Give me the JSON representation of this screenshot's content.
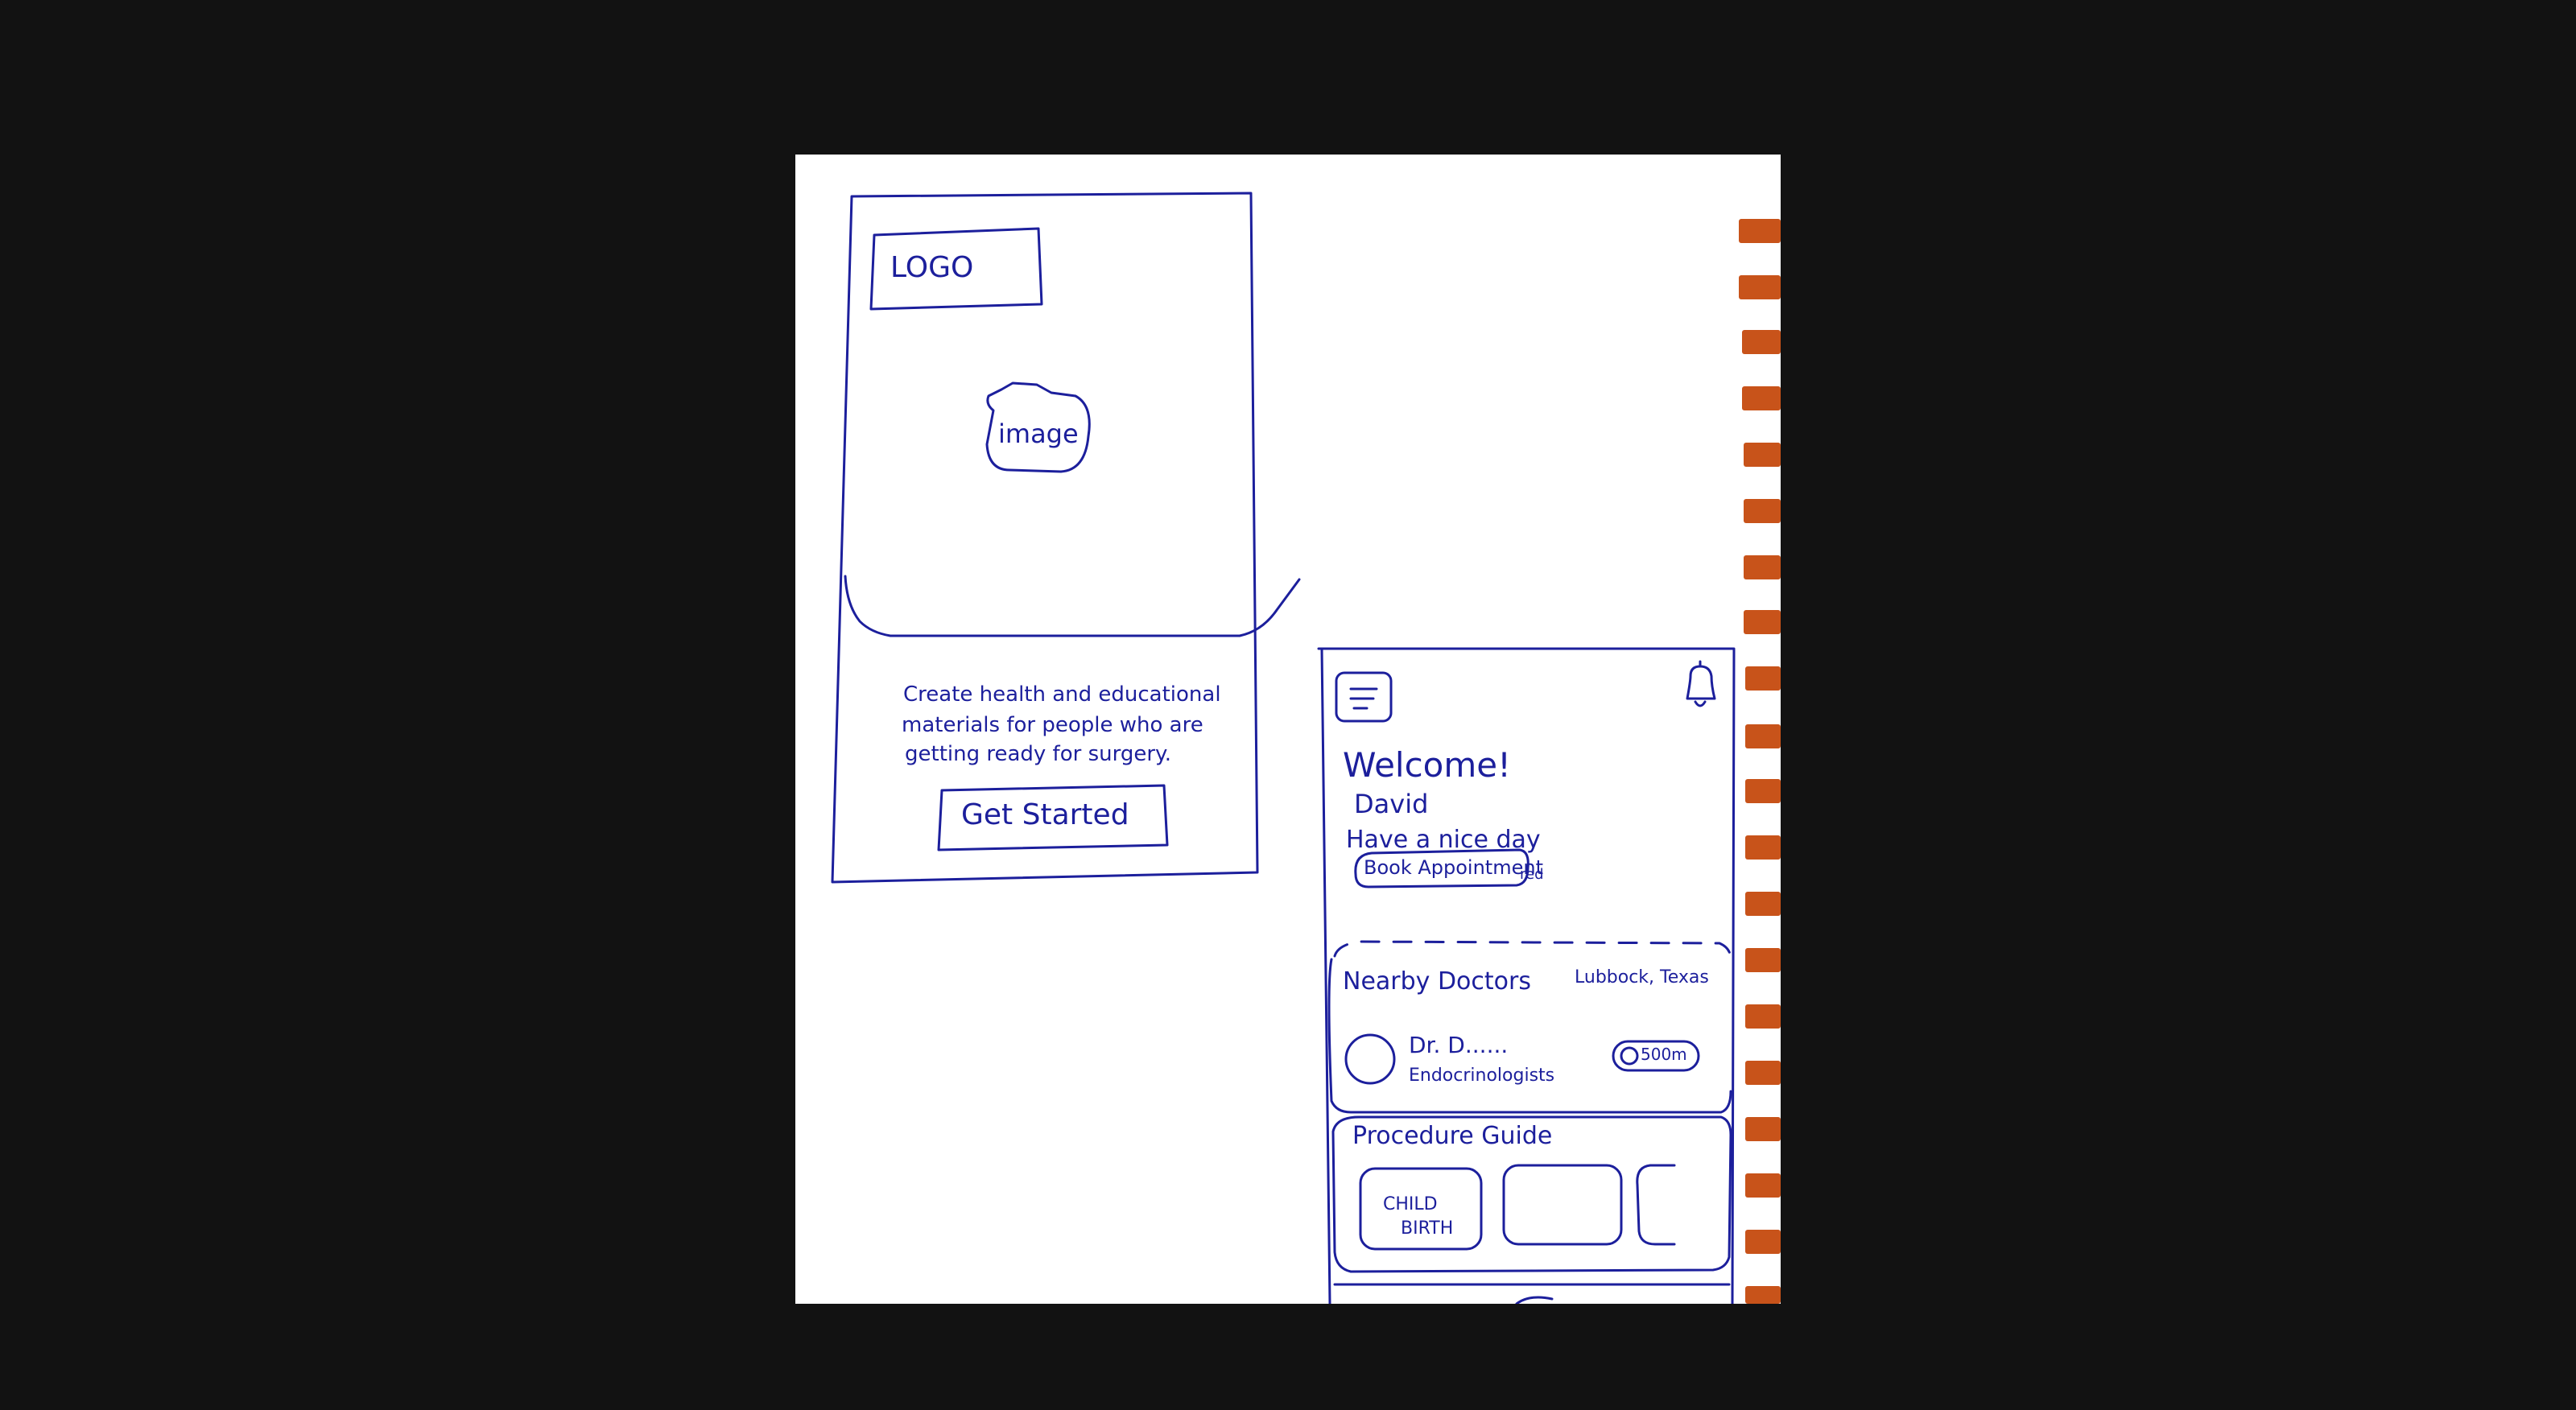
{
  "sketch": {
    "onboarding": {
      "logo_text": "LOGO",
      "image_text": "image",
      "description_lines": [
        "Create health and educational",
        "materials for people who are",
        "getting ready for surgery."
      ],
      "cta_label": "Get Started"
    },
    "home": {
      "welcome": "Welcome!",
      "user_name": "David",
      "greeting": "Have a nice day",
      "book_button": "Book Appointment",
      "book_note": "red",
      "nearby": {
        "title": "Nearby Doctors",
        "location": "Lubbock, Texas",
        "doctor_name": "Dr. D......",
        "specialty": "Endocrinologists",
        "distance": "500m"
      },
      "procedure": {
        "title": "Procedure Guide",
        "cards": [
          "CHILD\nBIRTH"
        ],
        "card1_line1": "CHILD",
        "card1_line2": "BIRTH"
      }
    }
  },
  "colors": {
    "ink": "#1c1f9c",
    "paper": "#ffffff",
    "background": "#121212",
    "tabs": "#c8531a"
  }
}
